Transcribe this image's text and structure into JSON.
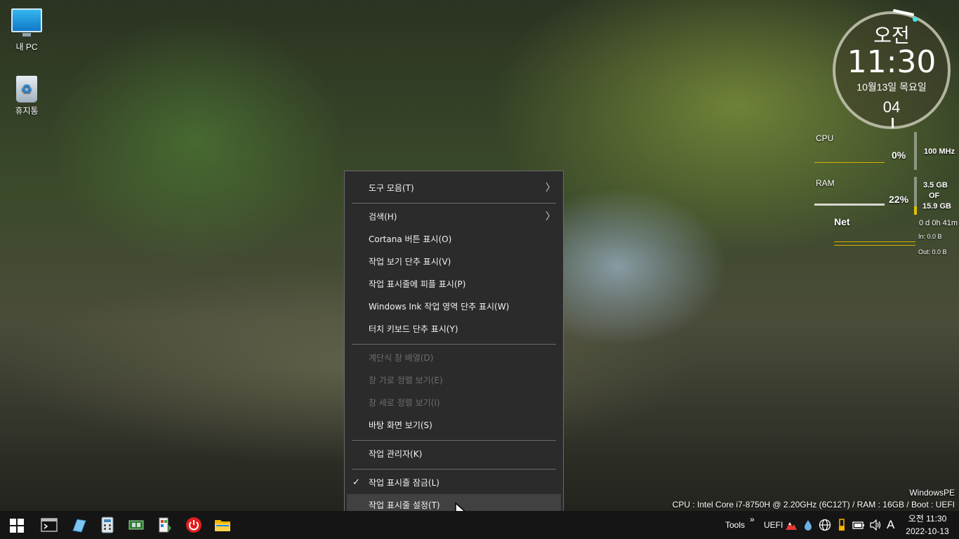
{
  "desktop": {
    "icons": [
      {
        "label": "내 PC",
        "icon": "monitor-icon"
      },
      {
        "label": "휴지통",
        "icon": "recycle-bin-icon"
      }
    ]
  },
  "clock": {
    "ampm": "오전",
    "time": "11:30",
    "date": "10월13일 목요일",
    "seconds": "04"
  },
  "sysmon": {
    "cpu_label": "CPU",
    "cpu_value": "0%",
    "cpu_freq": "100 MHz",
    "ram_label": "RAM",
    "ram_value": "22%",
    "ram_used": "3.5 GB",
    "ram_of": "OF",
    "ram_total": "15.9 GB",
    "net_label": "Net",
    "uptime": "0 d 0h 41m",
    "net_in": "In: 0.0 B",
    "net_out": "Out: 0.0 B",
    "ram_fraction": 0.22
  },
  "menu": {
    "items": [
      {
        "label": "도구 모음(T)",
        "submenu": true,
        "enabled": true
      },
      {
        "label": "검색(H)",
        "submenu": true,
        "enabled": true
      },
      {
        "label": "Cortana 버튼 표시(O)",
        "enabled": true
      },
      {
        "label": "작업 보기 단추 표시(V)",
        "enabled": true
      },
      {
        "label": "작업 표시줄에 피플 표시(P)",
        "enabled": true
      },
      {
        "label": "Windows Ink 작업 영역 단추 표시(W)",
        "enabled": true
      },
      {
        "label": "터치 키보드 단추 표시(Y)",
        "enabled": true
      },
      {
        "label": "계단식 창 배열(D)",
        "enabled": false
      },
      {
        "label": "창 가로 정렬 보기(E)",
        "enabled": false
      },
      {
        "label": "창 세로 정렬 보기(I)",
        "enabled": false
      },
      {
        "label": "바탕 화면 보기(S)",
        "enabled": true
      },
      {
        "label": "작업 관리자(K)",
        "enabled": true
      },
      {
        "label": "작업 표시줄 잠금(L)",
        "checked": true,
        "enabled": true
      },
      {
        "label": "작업 표시줄 설정(T)",
        "enabled": true,
        "highlighted": true
      }
    ],
    "arrow_glyph": "〉",
    "check_glyph": "✓"
  },
  "info": {
    "edition": "WindowsPE",
    "specs": "CPU : Intel Core i7-8750H @ 2.20GHz (6C12T) / RAM : 16GB / Boot : UEFI"
  },
  "taskbar": {
    "pinned": [
      "start-icon",
      "terminal-icon",
      "notepad-icon",
      "calculator-icon",
      "hardware-icon",
      "installer-icon",
      "power-icon",
      "folder-icon"
    ],
    "tools_label": "Tools",
    "overflow": "»",
    "uefi_label": "UEFI",
    "time": "오전 11:30",
    "date": "2022-10-13",
    "ime": "A"
  }
}
